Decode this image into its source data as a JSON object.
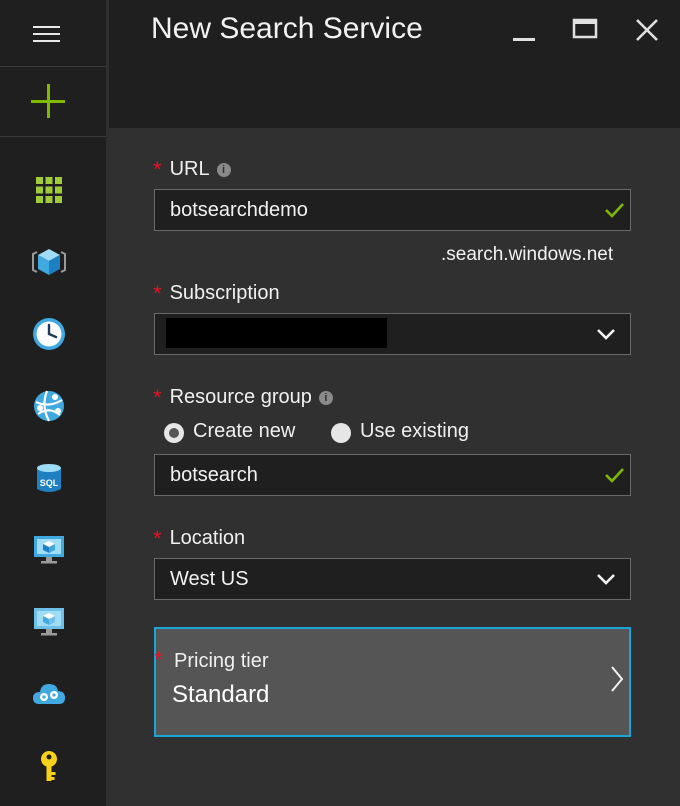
{
  "blade": {
    "title": "New Search Service"
  },
  "sidebar": {
    "items": [
      {
        "icon": "dashboard-grid-icon"
      },
      {
        "icon": "resource-cube-icon"
      },
      {
        "icon": "clock-icon"
      },
      {
        "icon": "network-globe-icon"
      },
      {
        "icon": "sql-database-icon"
      },
      {
        "icon": "virtual-machine-icon"
      },
      {
        "icon": "virtual-machine-classic-icon"
      },
      {
        "icon": "cloud-service-icon"
      },
      {
        "icon": "key-icon"
      }
    ]
  },
  "form": {
    "url": {
      "required_mark": "*",
      "label": "URL",
      "value": "botsearchdemo",
      "suffix": ".search.windows.net"
    },
    "subscription": {
      "required_mark": "*",
      "label": "Subscription"
    },
    "resource_group": {
      "required_mark": "*",
      "label": "Resource group",
      "option_new": "Create new",
      "option_existing": "Use existing",
      "selected": "Create new",
      "value": "botsearch"
    },
    "location": {
      "required_mark": "*",
      "label": "Location",
      "value": "West US"
    },
    "pricing_tier": {
      "required_mark": "*",
      "label": "Pricing tier",
      "value": "Standard"
    }
  },
  "colors": {
    "accent_green": "#7fba00",
    "required_red": "#e81123",
    "focus_blue": "#1aa5d8",
    "top_bar_orange": "#f7931e"
  }
}
